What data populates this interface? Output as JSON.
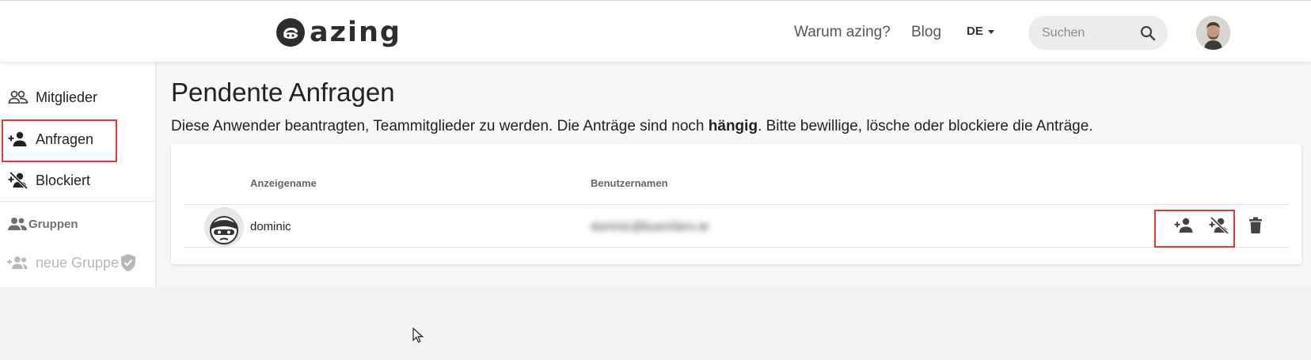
{
  "header": {
    "logo_text": "azing",
    "nav": [
      {
        "label": "Warum azing?"
      },
      {
        "label": "Blog"
      }
    ],
    "language": "DE",
    "search": {
      "placeholder": "Suchen",
      "value": ""
    }
  },
  "sidebar": {
    "items": [
      {
        "label": "Mitglieder",
        "icon": "members-icon"
      },
      {
        "label": "Anfragen",
        "icon": "person-add-icon",
        "selected": true
      },
      {
        "label": "Blockiert",
        "icon": "person-blocked-icon"
      }
    ],
    "groups_heading": "Gruppen",
    "new_group_label": "neue Gruppe"
  },
  "main": {
    "title": "Pendente Anfragen",
    "description_before": "Diese Anwender beantragten, Teammitglieder zu werden. Die Anträge sind noch ",
    "description_bold": "hängig",
    "description_after": ". Bitte bewillige, lösche oder blockiere die Anträge.",
    "table": {
      "columns": [
        "Anzeigename",
        "Benutzernamen"
      ],
      "rows": [
        {
          "display_name": "dominic",
          "username": "dominic@buechlers.at"
        }
      ]
    }
  },
  "colors": {
    "highlight": "#e53935",
    "text": "#222222",
    "muted": "#b4b8bd",
    "brand_dark": "#2b2d30"
  }
}
